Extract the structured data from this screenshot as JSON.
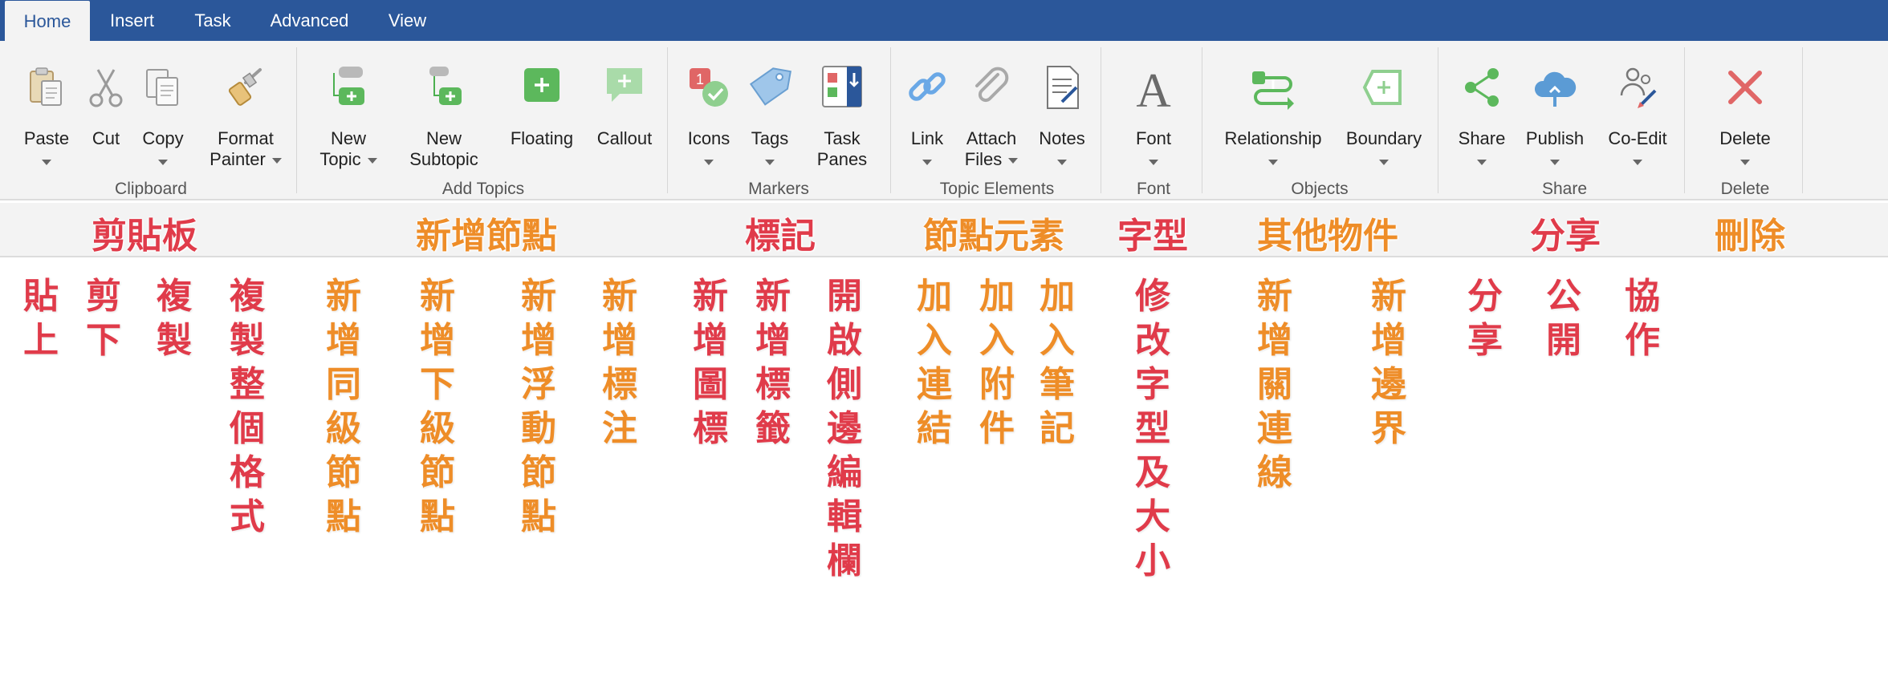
{
  "tabs": [
    {
      "label": "Home",
      "active": true
    },
    {
      "label": "Insert"
    },
    {
      "label": "Task"
    },
    {
      "label": "Advanced"
    },
    {
      "label": "View"
    }
  ],
  "ribbon": {
    "clipboard": {
      "group": "Clipboard",
      "paste": "Paste",
      "cut": "Cut",
      "copy": "Copy",
      "format1": "Format",
      "format2": "Painter"
    },
    "topics": {
      "group": "Add Topics",
      "new_topic1": "New",
      "new_topic2": "Topic",
      "new_sub1": "New",
      "new_sub2": "Subtopic",
      "floating": "Floating",
      "callout": "Callout"
    },
    "markers": {
      "group": "Markers",
      "icons": "Icons",
      "tags": "Tags",
      "task1": "Task",
      "task2": "Panes"
    },
    "elements": {
      "group": "Topic Elements",
      "link": "Link",
      "attach1": "Attach",
      "attach2": "Files",
      "notes": "Notes"
    },
    "font": {
      "group": "Font",
      "font": "Font"
    },
    "objects": {
      "group": "Objects",
      "relationship": "Relationship",
      "boundary": "Boundary"
    },
    "share": {
      "group": "Share",
      "share": "Share",
      "publish": "Publish",
      "coedit": "Co-Edit"
    },
    "delete": {
      "group": "Delete",
      "delete": "Delete"
    }
  },
  "annotations": {
    "headers": {
      "clipboard": "剪貼板",
      "topics": "新增節點",
      "markers": "標記",
      "elements": "節點元素",
      "font": "字型",
      "objects": "其他物件",
      "share": "分享",
      "delete": "刪除"
    },
    "items": {
      "paste": "貼上",
      "cut": "剪下",
      "copy": "複製",
      "format": "複製整個格式",
      "new_topic": "新增同級節點",
      "new_sub": "新增下級節點",
      "floating": "新增浮動節點",
      "callout": "新增標注",
      "icons": "新增圖標",
      "tags": "新增標籤",
      "task": "開啟側邊編輯欄",
      "link": "加入連結",
      "attach": "加入附件",
      "notes": "加入筆記",
      "font": "修改字型及大小",
      "relationship": "新增關連線",
      "boundary": "新增邊界",
      "share": "分享",
      "publish": "公開",
      "coedit": "協作"
    }
  },
  "colors": {
    "tabbar": "#2b579a",
    "red": "#e03b4a",
    "orange": "#ee8d28",
    "green": "#4caf50"
  }
}
